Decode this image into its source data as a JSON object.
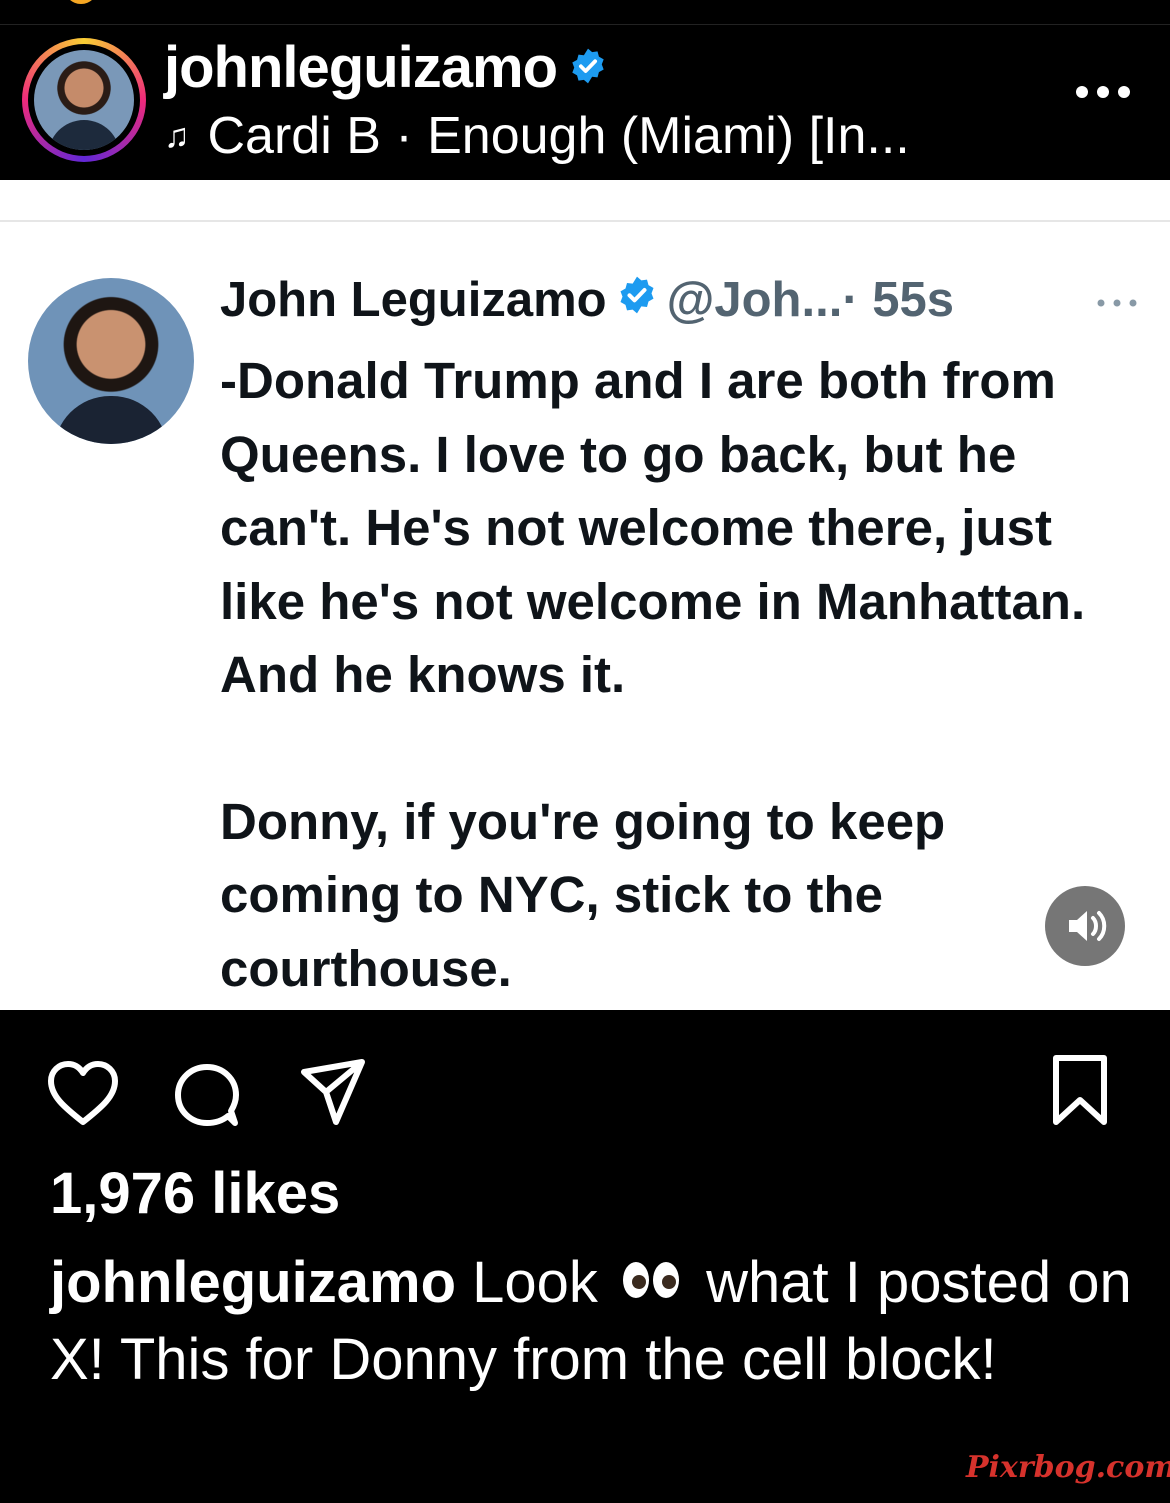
{
  "post": {
    "username": "johnleguizamo",
    "music": "Cardi B · Enough (Miami) [In..."
  },
  "tweet": {
    "name": "John Leguizamo",
    "handle": "@Joh...",
    "time": "· 55s",
    "paragraph1": "-Donald Trump and I are both from Queens. I love to go back, but he can't. He's not welcome there, just like he's not welcome in Manhattan. And he knows it.",
    "paragraph2": "Donny, if you're going to keep coming to NYC, stick to the courthouse."
  },
  "engagement": {
    "likes": "1,976 likes"
  },
  "caption": {
    "user": "johnleguizamo",
    "text_before": " Look",
    "emoji": "👀",
    "text_after": " what I posted on X!  This for Donny from the cell block!"
  },
  "watermark": "Pixrbog.com",
  "colors": {
    "verified": "#1d9bf0",
    "background": "#000000",
    "tweet_bg": "#ffffff",
    "watermark": "#d6322c"
  },
  "icons": [
    "verified-badge-icon",
    "music-note-icon",
    "more-icon",
    "heart-icon",
    "comment-icon",
    "share-icon",
    "bookmark-icon",
    "speaker-icon",
    "eyes-emoji-icon"
  ]
}
